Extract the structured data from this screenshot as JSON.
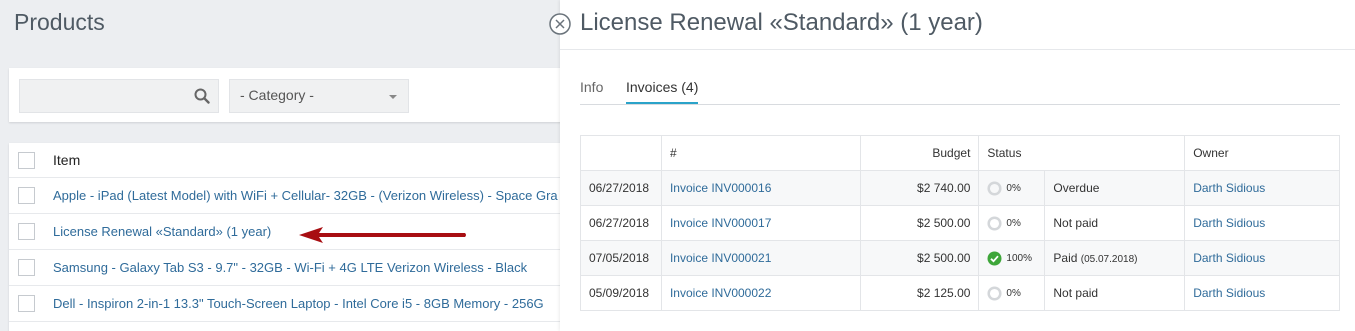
{
  "page": {
    "title": "Products"
  },
  "filters": {
    "search_placeholder": "",
    "category_label": "- Category -"
  },
  "products": {
    "header": "Item",
    "rows": [
      "Apple - iPad (Latest Model) with WiFi + Cellular- 32GB - (Verizon Wireless) - Space Gra",
      "License Renewal «Standard» (1 year)",
      "Samsung - Galaxy Tab S3 - 9.7\" - 32GB - Wi-Fi + 4G LTE Verizon Wireless - Black",
      "Dell - Inspiron 2-in-1 13.3\" Touch-Screen Laptop - Intel Core i5 - 8GB Memory - 256G"
    ]
  },
  "panel": {
    "title": "License Renewal «Standard» (1 year)",
    "tabs": [
      "Info",
      "Invoices (4)"
    ],
    "active_tab": "Invoices (4)",
    "columns": {
      "date": "",
      "number": "#",
      "budget": "Budget",
      "status": "Status",
      "owner": "Owner"
    },
    "invoices": [
      {
        "date": "06/27/2018",
        "number": "Invoice INV000016",
        "budget": "$2 740.00",
        "percent": "0%",
        "status": "Overdue",
        "status_extra": "",
        "owner": "Darth Sidious"
      },
      {
        "date": "06/27/2018",
        "number": "Invoice INV000017",
        "budget": "$2 500.00",
        "percent": "0%",
        "status": "Not paid",
        "status_extra": "",
        "owner": "Darth Sidious"
      },
      {
        "date": "07/05/2018",
        "number": "Invoice INV000021",
        "budget": "$2 500.00",
        "percent": "100%",
        "status": "Paid",
        "status_extra": "(05.07.2018)",
        "owner": "Darth Sidious"
      },
      {
        "date": "05/09/2018",
        "number": "Invoice INV000022",
        "budget": "$2 125.00",
        "percent": "0%",
        "status": "Not paid",
        "status_extra": "",
        "owner": "Darth Sidious"
      }
    ]
  },
  "colors": {
    "link": "#2f6b9a",
    "accent": "#2aa3c9",
    "overdue": "#d8605c",
    "paid": "#2eb2c9",
    "success": "#3ea63a",
    "arrow": "#a80e12"
  },
  "icons": {
    "search": "search-icon",
    "close": "close-icon",
    "dropdown": "chevron-down-icon",
    "progress": "progress-ring-icon",
    "check": "check-circle-icon",
    "pointer": "arrow-left-icon"
  }
}
